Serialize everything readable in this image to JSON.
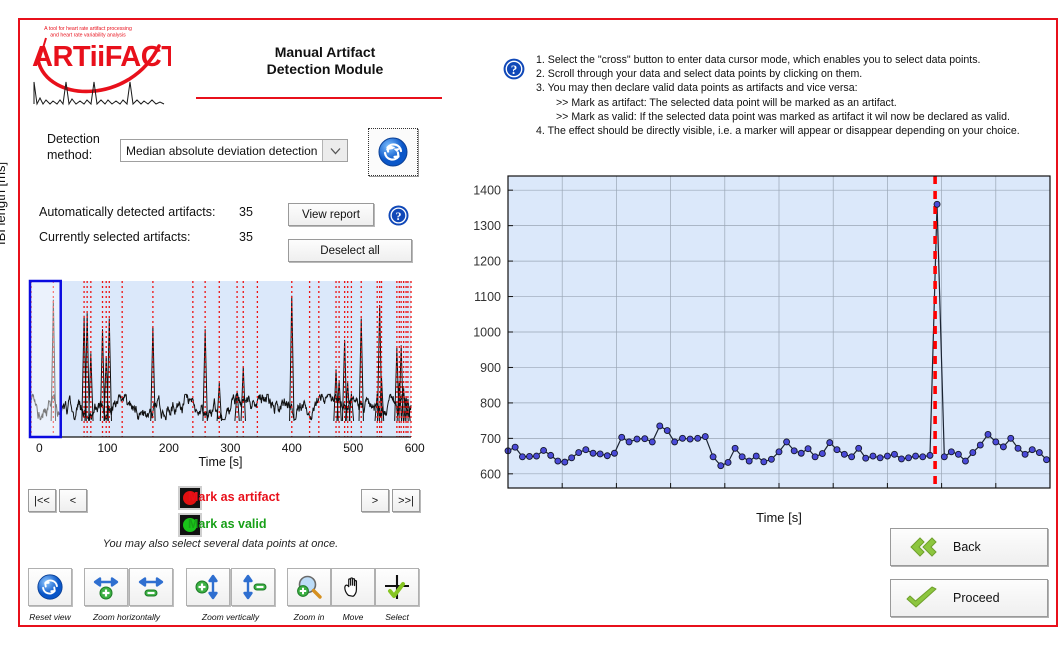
{
  "window": {
    "frame_color": "#e8101b"
  },
  "logo": {
    "brand": "ARTiiFACT",
    "tagline_line1": "A tool for heart rate artifact processing",
    "tagline_line2": "and heart rate variability analysis"
  },
  "header": {
    "title_line1": "Manual Artifact",
    "title_line2": "Detection Module"
  },
  "detection": {
    "label_line1": "Detection",
    "label_line2": "method:",
    "selected": "Median absolute deviation detection",
    "options": [
      "Median absolute deviation detection"
    ],
    "refresh_icon": "refresh-icon"
  },
  "counts": {
    "auto_label": "Automatically detected artifacts:",
    "auto_value": "35",
    "selected_label": "Currently selected artifacts:",
    "selected_value": "35",
    "view_report": "View report",
    "deselect_all": "Deselect all",
    "help_icon": "help-icon"
  },
  "navigation": {
    "first": "|<<",
    "prev": "<",
    "next": ">",
    "last": ">>|"
  },
  "marking": {
    "artifact_label": "Mark as artifact",
    "artifact_color": "#e8101b",
    "valid_label": "Mark as valid",
    "valid_color": "#18a018",
    "hint": "You may also select several data points at once."
  },
  "toolbar": {
    "items": [
      {
        "name": "reset-view",
        "caption": "Reset view",
        "icon": "refresh-icon",
        "x": 28
      },
      {
        "name": "zoom-horizontally-in",
        "caption": "",
        "icon": "arrows-horizontal-plus-icon",
        "x": 84
      },
      {
        "name": "zoom-horizontally-out",
        "caption": "",
        "icon": "arrows-horizontal-minus-icon",
        "x": 129
      },
      {
        "name": "zoom-vertically-in",
        "caption": "",
        "icon": "arrows-vertical-plus-icon",
        "x": 186
      },
      {
        "name": "zoom-vertically-out",
        "caption": "",
        "icon": "arrows-vertical-minus-icon",
        "x": 231
      },
      {
        "name": "zoom-in",
        "caption": "Zoom in",
        "icon": "magnifier-plus-icon",
        "x": 287
      },
      {
        "name": "move",
        "caption": "Move",
        "icon": "hand-icon",
        "x": 331
      },
      {
        "name": "select",
        "caption": "Select",
        "icon": "cross-check-icon",
        "x": 375
      }
    ],
    "captions": [
      {
        "text": "Reset view",
        "x": 28,
        "w": 44
      },
      {
        "text": "Zoom horizontally",
        "x": 67,
        "w": 119
      },
      {
        "text": "Zoom vertically",
        "x": 172,
        "w": 117
      },
      {
        "text": "Zoom in",
        "x": 287,
        "w": 44
      },
      {
        "text": "Move",
        "x": 331,
        "w": 44
      },
      {
        "text": "Select",
        "x": 375,
        "w": 44
      }
    ]
  },
  "instructions": {
    "icon": "help-icon",
    "lines": [
      {
        "text": "1. Select the \"cross\" button to enter data cursor mode, which enables you to select data points.",
        "indent": false
      },
      {
        "text": "2. Scroll through your data and select data points by clicking on them.",
        "indent": false
      },
      {
        "text": "3. You may then declare valid data points as artifacts and vice versa:",
        "indent": false
      },
      {
        "text": ">> Mark as artifact: The selected data point will be marked as an artifact.",
        "indent": true
      },
      {
        "text": ">> Mark as valid: If the selected data point was marked as artifact it wil now be declared as valid.",
        "indent": true
      },
      {
        "text": "4. The effect should be directly visible, i.e. a marker will appear or disappear depending on your choice.",
        "indent": false
      }
    ]
  },
  "actions": {
    "back": "Back",
    "back_icon": "double-chevron-left-icon",
    "proceed": "Proceed",
    "proceed_icon": "checkmark-icon"
  },
  "overview_chart": {
    "xlabel": "Time [s]",
    "xticks": [
      "0",
      "100",
      "200",
      "300",
      "400",
      "500",
      "600"
    ],
    "xlim": [
      0,
      620
    ],
    "selection_window": [
      0,
      50
    ],
    "selection_color": "#0a0ae0",
    "artifact_marker_color": "#ee1111",
    "background": "#dbe8fa"
  },
  "chart_data": {
    "type": "line",
    "title": "",
    "xlabel": "Time [s]",
    "ylabel": "IBI length [ms]",
    "xlim": [
      0,
      50
    ],
    "ylim": [
      560,
      1440
    ],
    "xticks": [
      0,
      5,
      10,
      15,
      20,
      25,
      30,
      35,
      40,
      45,
      50
    ],
    "ytick_labels": [
      "600",
      "700",
      "800",
      "900",
      "1000",
      "1100",
      "1200",
      "1300",
      "1400"
    ],
    "yticks": [
      600,
      700,
      800,
      900,
      1000,
      1100,
      1200,
      1300,
      1400
    ],
    "grid": true,
    "legend": "none",
    "marker": "circle",
    "marker_face_color": "#4a4ad8",
    "line_color": "#1b2433",
    "plot_background": "#dbe8fa",
    "cursor_line": {
      "x": 39.4,
      "color": "#ff0000",
      "style": "dashed"
    },
    "series": [
      {
        "name": "IBI length",
        "x": [
          0.0,
          0.66,
          1.33,
          1.98,
          2.63,
          3.28,
          3.94,
          4.6,
          5.24,
          5.87,
          6.52,
          7.18,
          7.85,
          8.5,
          9.16,
          9.82,
          10.49,
          11.17,
          11.9,
          12.62,
          13.31,
          14.0,
          14.69,
          15.37,
          16.1,
          16.8,
          17.5,
          18.2,
          18.92,
          19.63,
          20.3,
          20.95,
          21.6,
          22.25,
          22.9,
          23.6,
          24.3,
          25.0,
          25.7,
          26.4,
          27.05,
          27.68,
          28.33,
          29.0,
          29.68,
          30.35,
          31.03,
          31.7,
          32.35,
          33.0,
          33.67,
          34.33,
          35.0,
          35.65,
          36.3,
          36.95,
          37.6,
          38.26,
          38.93,
          39.58,
          40.25,
          40.9,
          41.55,
          42.2,
          42.88,
          43.57,
          44.28,
          45.0,
          45.7,
          46.38,
          47.05,
          47.7,
          48.36,
          49.02,
          49.68
        ],
        "y": [
          665,
          675,
          648,
          649,
          650,
          666,
          652,
          636,
          633,
          645,
          660,
          668,
          658,
          656,
          651,
          658,
          703,
          690,
          698,
          699,
          690,
          735,
          722,
          690,
          700,
          698,
          700,
          705,
          648,
          623,
          632,
          672,
          648,
          636,
          650,
          634,
          641,
          662,
          690,
          665,
          658,
          671,
          648,
          657,
          688,
          668,
          655,
          648,
          672,
          644,
          650,
          645,
          650,
          655,
          642,
          645,
          650,
          648,
          652,
          1360,
          648,
          662,
          655,
          636,
          660,
          681,
          711,
          690,
          676,
          700,
          672,
          655,
          668,
          660,
          640
        ]
      }
    ]
  }
}
